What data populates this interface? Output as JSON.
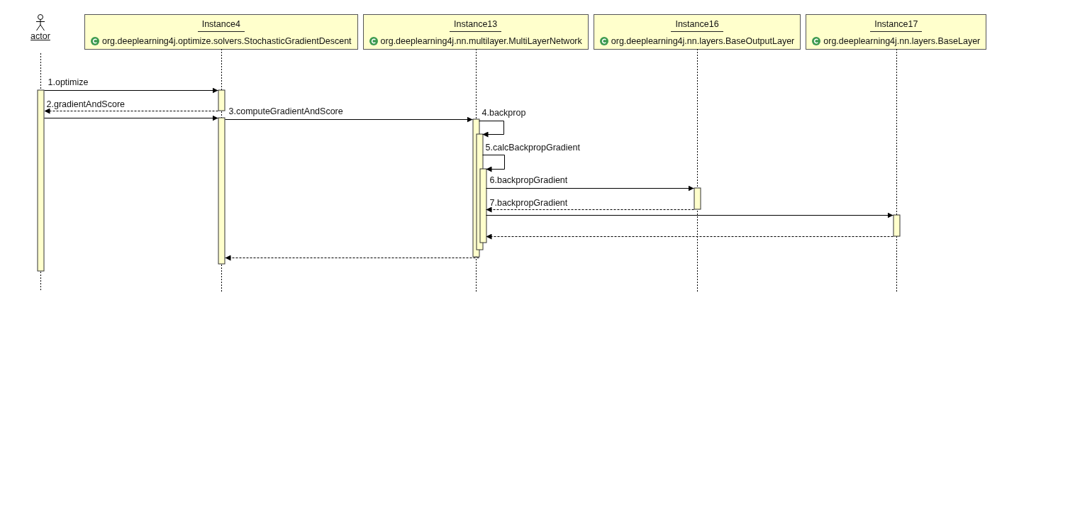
{
  "actor": {
    "name": "actor"
  },
  "participants": [
    {
      "instance": "Instance4",
      "class": "org.deeplearning4j.optimize.solvers.StochasticGradientDescent"
    },
    {
      "instance": "Instance13",
      "class": "org.deeplearning4j.nn.multilayer.MultiLayerNetwork"
    },
    {
      "instance": "Instance16",
      "class": "org.deeplearning4j.nn.layers.BaseOutputLayer"
    },
    {
      "instance": "Instance17",
      "class": "org.deeplearning4j.nn.layers.BaseLayer"
    }
  ],
  "messages": [
    {
      "label": "1.optimize",
      "kind": "call"
    },
    {
      "label": "2.gradientAndScore",
      "kind": "return"
    },
    {
      "kind": "call"
    },
    {
      "label": "3.computeGradientAndScore",
      "kind": "call"
    },
    {
      "label": "4.backprop",
      "kind": "self"
    },
    {
      "label": "5.calcBackpropGradient",
      "kind": "self"
    },
    {
      "label": "6.backpropGradient",
      "kind": "call"
    },
    {
      "label": "7.backpropGradient",
      "kind": "return"
    },
    {
      "kind": "call"
    },
    {
      "kind": "return"
    },
    {
      "kind": "return"
    }
  ]
}
